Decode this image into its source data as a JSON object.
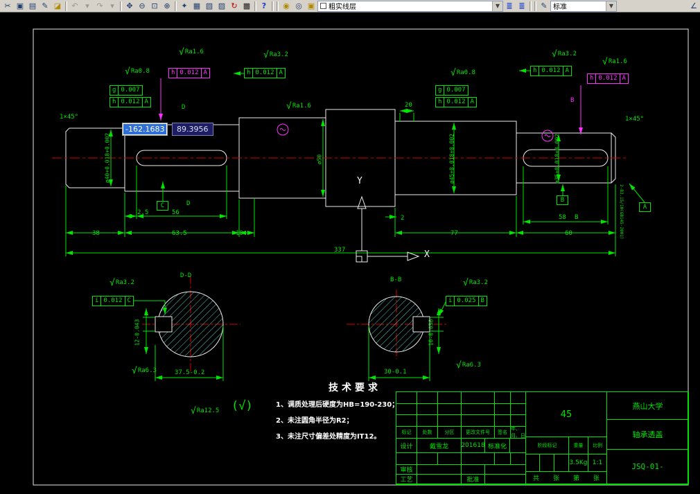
{
  "toolbar": {
    "layer_combo": "粗实线层",
    "style_combo": "标准",
    "icons": [
      {
        "name": "cut",
        "glyph": "✂"
      },
      {
        "name": "copy",
        "glyph": "▣"
      },
      {
        "name": "paste",
        "glyph": "▤"
      },
      {
        "name": "format-brush",
        "glyph": "✎"
      },
      {
        "name": "erase",
        "glyph": "◪"
      },
      {
        "name": "undo",
        "glyph": "↶"
      },
      {
        "name": "undo-more",
        "glyph": "▾"
      },
      {
        "name": "redo",
        "glyph": "↷"
      },
      {
        "name": "redo-more",
        "glyph": "▾"
      },
      {
        "name": "pan",
        "glyph": "✥"
      },
      {
        "name": "zoom-out",
        "glyph": "⊖"
      },
      {
        "name": "zoom-window",
        "glyph": "⊡"
      },
      {
        "name": "zoom-in",
        "glyph": "⊕"
      },
      {
        "name": "regen",
        "glyph": "✦"
      },
      {
        "name": "grid",
        "glyph": "▦"
      },
      {
        "name": "layout",
        "glyph": "▧"
      },
      {
        "name": "render",
        "glyph": "▨"
      },
      {
        "name": "update",
        "glyph": "↻"
      },
      {
        "name": "table",
        "glyph": "▩"
      },
      {
        "name": "help",
        "glyph": "?"
      },
      {
        "name": "layer-bulb",
        "glyph": "◉"
      },
      {
        "name": "layer-freeze",
        "glyph": "◎"
      },
      {
        "name": "layer-lock",
        "glyph": "▣"
      },
      {
        "name": "layers-a",
        "glyph": "≣"
      },
      {
        "name": "layers-b",
        "glyph": "≣"
      },
      {
        "name": "text-style",
        "glyph": "✎"
      },
      {
        "name": "measure",
        "glyph": "∠"
      }
    ]
  },
  "dyn_input": {
    "x_value": "-162.1683",
    "y_value": "89.3956"
  },
  "ucs": {
    "x_label": "X",
    "y_label": "Y"
  },
  "rough": {
    "check": "√",
    "r1": "Ra1.6",
    "r2": "Ra0.8",
    "r3": "Ra3.2",
    "r4": "Ra1.6",
    "r5": "Ra0.8",
    "r6": "Ra3.2",
    "r7": "Ra1.6",
    "r8": "Ra3.2",
    "r9": "Ra6.3",
    "r10": "Ra3.2",
    "r11": "Ra6.3",
    "r12": "Ra12.5",
    "others": "(√)"
  },
  "frames": {
    "f1": {
      "c1": "h",
      "c2": "0.012",
      "c3": "A"
    },
    "f2a": {
      "c1": "g",
      "c2": "0.007"
    },
    "f2b": {
      "c1": "h",
      "c2": "0.012",
      "c3": "A"
    },
    "f3": {
      "c1": "h",
      "c2": "0.012",
      "c3": "A"
    },
    "f4a": {
      "c1": "g",
      "c2": "0.007"
    },
    "f4b": {
      "c1": "h",
      "c2": "0.012",
      "c3": "A"
    },
    "f5": {
      "c1": "h",
      "c2": "0.012",
      "c3": "A"
    },
    "f6": {
      "c1": "h",
      "c2": "0.012",
      "c3": "A"
    },
    "f7": {
      "c1": "i",
      "c2": "0.012",
      "c3": "C"
    },
    "f8": {
      "c1": "i",
      "c2": "0.025",
      "c3": "B"
    }
  },
  "datums": {
    "c": "C",
    "b": "B",
    "a": "A",
    "d_top": "D",
    "d_bot": "D",
    "b_cut": "B",
    "b_ref": "B"
  },
  "notes": {
    "center_hole": "2-B3.15/10(GB145-2001)"
  },
  "dims": {
    "chamfer_left": "1×45°",
    "chamfer_right": "1×45°",
    "len20": "20",
    "len2_5": "2.5",
    "len56": "56",
    "len38": "38",
    "len63_5": "63.5",
    "len10": "10",
    "len337": "337",
    "len77": "77",
    "len60": "60",
    "len2": "2",
    "len58": "58",
    "dia1": "ø40+0.018+0.002",
    "dia3": "ø50",
    "dia4": "ø45+0.018+0.002",
    "dia5": "ø35+0.018+0.002"
  },
  "sections": {
    "dd": {
      "title": "D-D",
      "key_width": "12-0.043",
      "flat": "37.5-0.2"
    },
    "bb": {
      "title": "B-B",
      "key_width": "10-0.036",
      "flat": "30-0.1"
    }
  },
  "tech": {
    "title": "技术要求",
    "l1": "1、调质处理后硬度为HB=190-230；",
    "l2": "2、未注圆角半径为R2；",
    "l3": "3、未注尺寸偏差处精度为IT12。"
  },
  "tb": {
    "h_mark": "标记",
    "h_count": "处数",
    "h_zone": "分区",
    "h_change": "更改文件号",
    "h_sign": "签名",
    "h_date": "年、月、日",
    "design": "设计",
    "designer": "戴雪龙",
    "date": "201618",
    "standardize": "标准化",
    "audit": "审核",
    "craft": "工艺",
    "approve": "批准",
    "material": "45",
    "school": "燕山大学",
    "part": "轴承透盖",
    "dwg_no": "JSQ-01-",
    "stage": "阶段标记",
    "weight_h": "重量",
    "scale_h": "比例",
    "weight": "3.5Kg",
    "scale": "1:1",
    "sh1": "共",
    "sh2": "张",
    "sh3": "第",
    "sh4": "张"
  },
  "colors": {
    "dim_green": "#00e400",
    "outline_white": "#ededed",
    "centerline_red": "#d40000",
    "hatch_cyan": "#56c8c8",
    "tol_magenta": "#ff30ff",
    "select_blue": "#2f6fd6"
  }
}
